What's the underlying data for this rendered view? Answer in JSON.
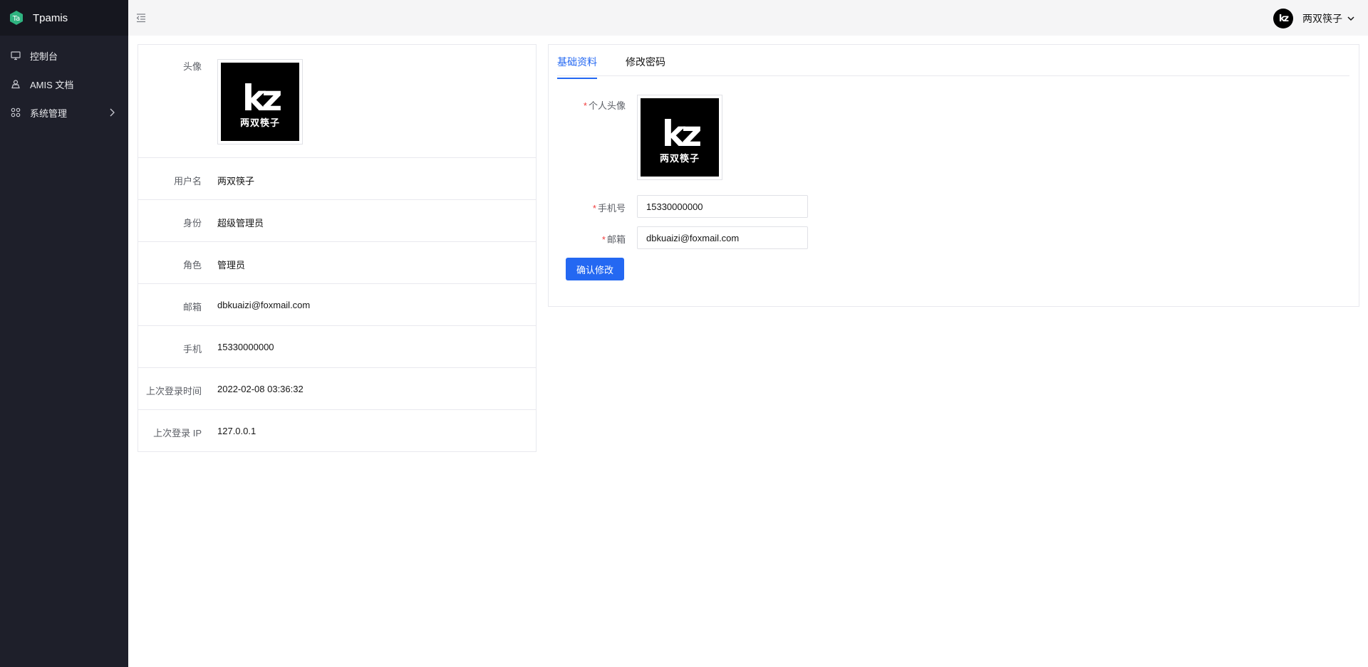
{
  "app": {
    "name": "Tpamis",
    "logo_text": "Ta",
    "logo_color": "#2fb380"
  },
  "sidebar": {
    "items": [
      {
        "label": "控制台",
        "icon": "monitor-icon"
      },
      {
        "label": "AMIS 文档",
        "icon": "document-icon"
      },
      {
        "label": "系统管理",
        "icon": "grid-icon",
        "has_children": true
      }
    ]
  },
  "topbar": {
    "collapse_icon": "menu-fold-icon",
    "user_name": "两双筷子"
  },
  "avatar": {
    "logo": "kz",
    "caption": "两双筷子"
  },
  "profile": {
    "avatar_label": "头像",
    "rows": [
      {
        "label": "用户名",
        "value": "两双筷子"
      },
      {
        "label": "身份",
        "value": "超级管理员"
      },
      {
        "label": "角色",
        "value": "管理员"
      },
      {
        "label": "邮箱",
        "value": "dbkuaizi@foxmail.com"
      },
      {
        "label": "手机",
        "value": "15330000000"
      },
      {
        "label": "上次登录时间",
        "value": "2022-02-08 03:36:32"
      },
      {
        "label": "上次登录 IP",
        "value": "127.0.0.1"
      }
    ]
  },
  "edit": {
    "tabs": [
      {
        "label": "基础资料",
        "active": true
      },
      {
        "label": "修改密码",
        "active": false
      }
    ],
    "required_mark": "*",
    "avatar_label": "个人头像",
    "phone_label": "手机号",
    "phone_value": "15330000000",
    "email_label": "邮箱",
    "email_value": "dbkuaizi@foxmail.com",
    "submit_label": "确认修改"
  },
  "colors": {
    "sidebar_bg": "#1e1f2a",
    "brand_bg": "#16171f",
    "primary": "#2468f2",
    "required": "#f23d3d"
  }
}
